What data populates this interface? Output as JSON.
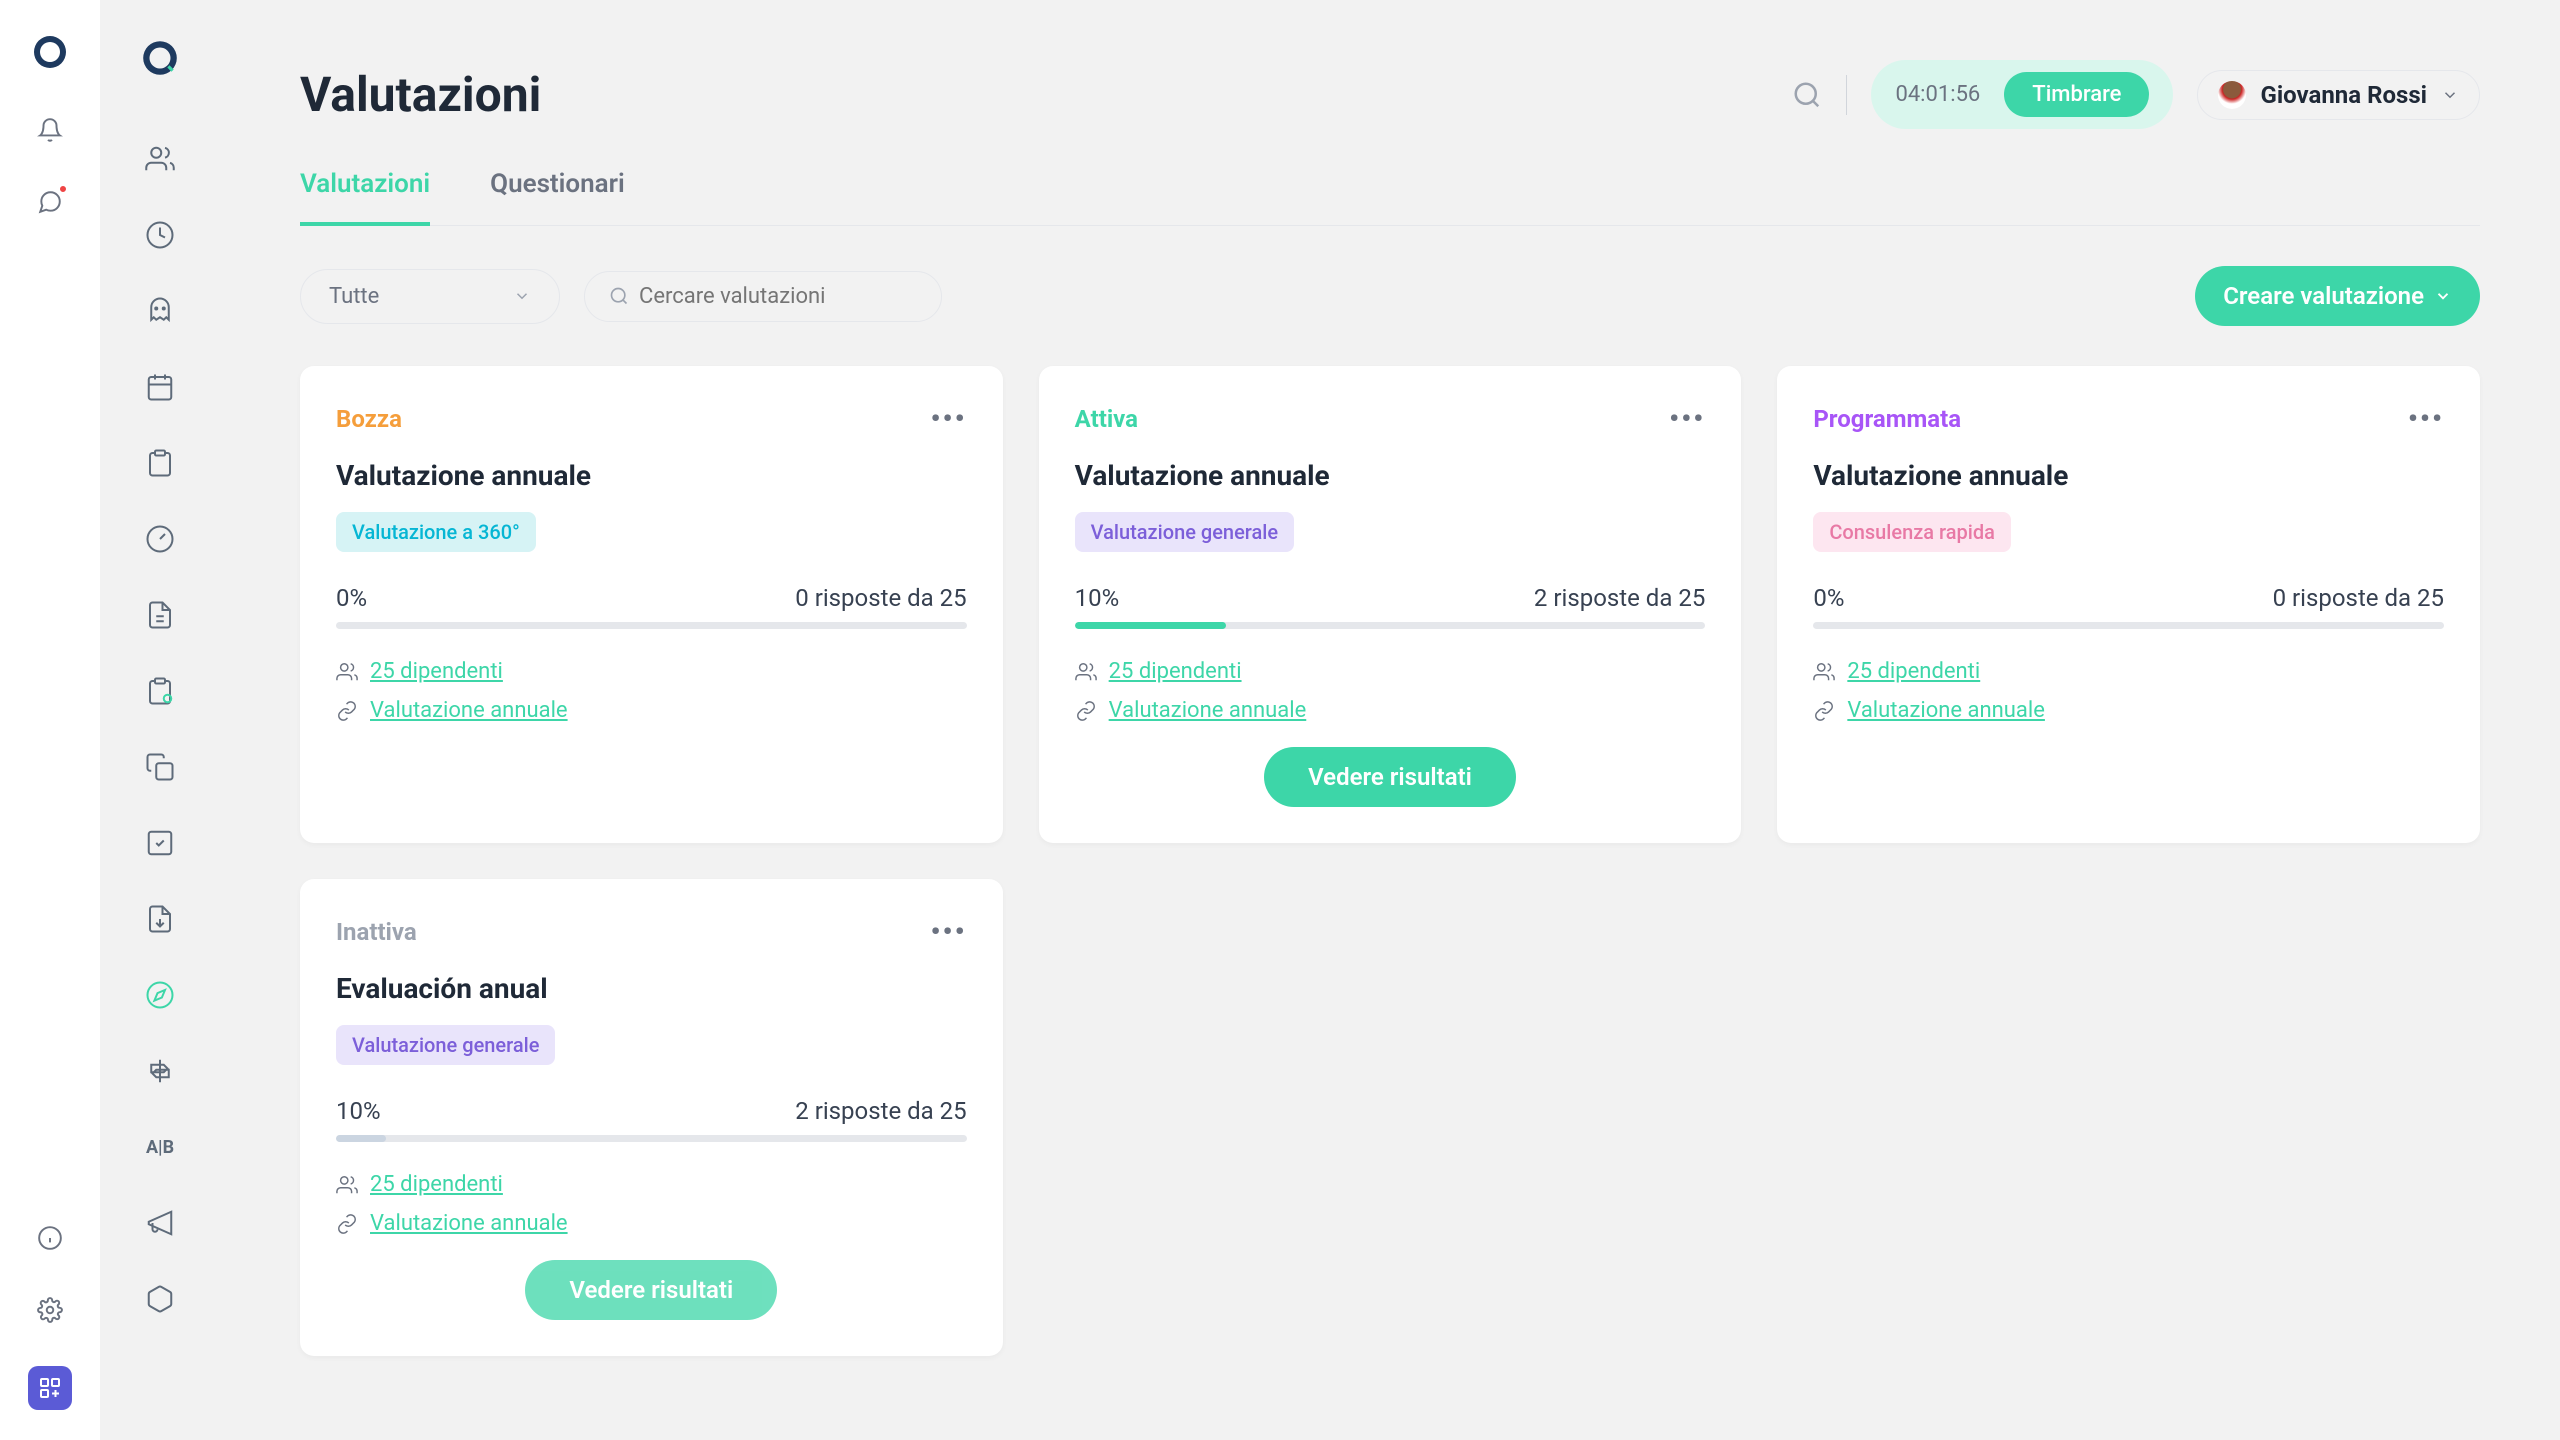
{
  "header": {
    "title": "Valutazioni",
    "timer": "04:01:56",
    "timer_btn": "Timbrare",
    "user_name": "Giovanna Rossi"
  },
  "tabs": [
    {
      "label": "Valutazioni",
      "active": true
    },
    {
      "label": "Questionari",
      "active": false
    }
  ],
  "controls": {
    "filter_value": "Tutte",
    "search_placeholder": "Cercare valutazioni",
    "create_label": "Creare valutazione"
  },
  "cards": [
    {
      "status": "Bozza",
      "status_class": "status-bozza",
      "title": "Valutazione annuale",
      "type": "Valutazione a 360°",
      "type_class": "chip-360",
      "pct": "0%",
      "responses": "0 risposte da 25",
      "fill_pct": 0,
      "employees": "25 dipendenti ",
      "link": "Valutazione annuale",
      "show_results": false
    },
    {
      "status": "Attiva",
      "status_class": "status-attiva",
      "title": "Valutazione annuale",
      "type": "Valutazione generale",
      "type_class": "chip-general",
      "pct": "10%",
      "responses": "2 risposte da 25",
      "fill_pct": 24,
      "employees": "25 dipendenti ",
      "link": "Valutazione annuale",
      "show_results": true,
      "results_label": "Vedere risultati"
    },
    {
      "status": "Programmata",
      "status_class": "status-programmata",
      "title": "Valutazione annuale",
      "type": "Consulenza rapida",
      "type_class": "chip-fast",
      "pct": "0%",
      "responses": "0 risposte da 25",
      "fill_pct": 0,
      "employees": "25 dipendenti ",
      "link": "Valutazione annuale",
      "show_results": false
    },
    {
      "status": "Inattiva",
      "status_class": "status-inattiva",
      "title": "Evaluación anual",
      "type": "Valutazione generale",
      "type_class": "chip-general",
      "pct": "10%",
      "responses": "2 risposte da 25",
      "fill_pct": 8,
      "fill_grey": true,
      "employees": "25 dipendenti ",
      "link": "Valutazione annuale",
      "show_results": true,
      "results_label": "Vedere risultati",
      "results_faded": true
    }
  ]
}
